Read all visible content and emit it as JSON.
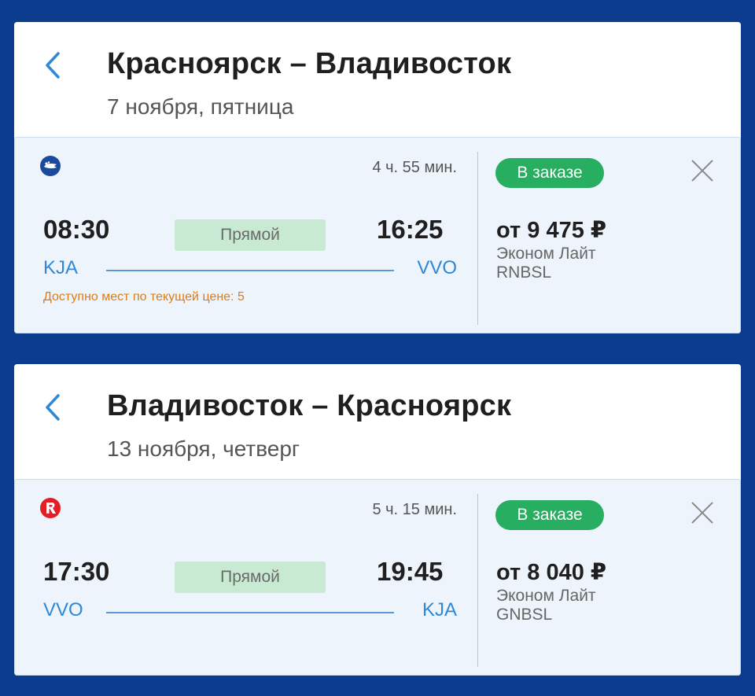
{
  "colors": {
    "background": "#0b3c8e",
    "accent_blue": "#2f87d6",
    "badge_green": "#27ae60",
    "direct_green": "#c8ead3",
    "seats_orange": "#e07b12"
  },
  "segments": [
    {
      "back_icon": "chevron-left-icon",
      "title": "Красноярск – Владивосток",
      "date": "7 ноября, пятница",
      "flight": {
        "airline_logo": "aeroflot-style-logo-icon",
        "duration": "4 ч. 55 мин.",
        "departure_time": "08:30",
        "arrival_time": "16:25",
        "direct_label": "Прямой",
        "departure_airport": "KJA",
        "arrival_airport": "VVO",
        "seats_left": "Доступно мест по текущей цене: 5",
        "status": "В заказе",
        "close_icon": "close-icon",
        "price": "от 9 475 ₽",
        "fare_name": "Эконом Лайт",
        "fare_code": "RNBSL"
      }
    },
    {
      "back_icon": "chevron-left-icon",
      "title": "Владивосток – Красноярск",
      "date": "13 ноября, четверг",
      "flight": {
        "airline_logo": "red-r-logo-icon",
        "duration": "5 ч. 15 мин.",
        "departure_time": "17:30",
        "arrival_time": "19:45",
        "direct_label": "Прямой",
        "departure_airport": "VVO",
        "arrival_airport": "KJA",
        "seats_left": "",
        "status": "В заказе",
        "close_icon": "close-icon",
        "price": "от 8 040 ₽",
        "fare_name": "Эконом Лайт",
        "fare_code": "GNBSL"
      }
    }
  ]
}
